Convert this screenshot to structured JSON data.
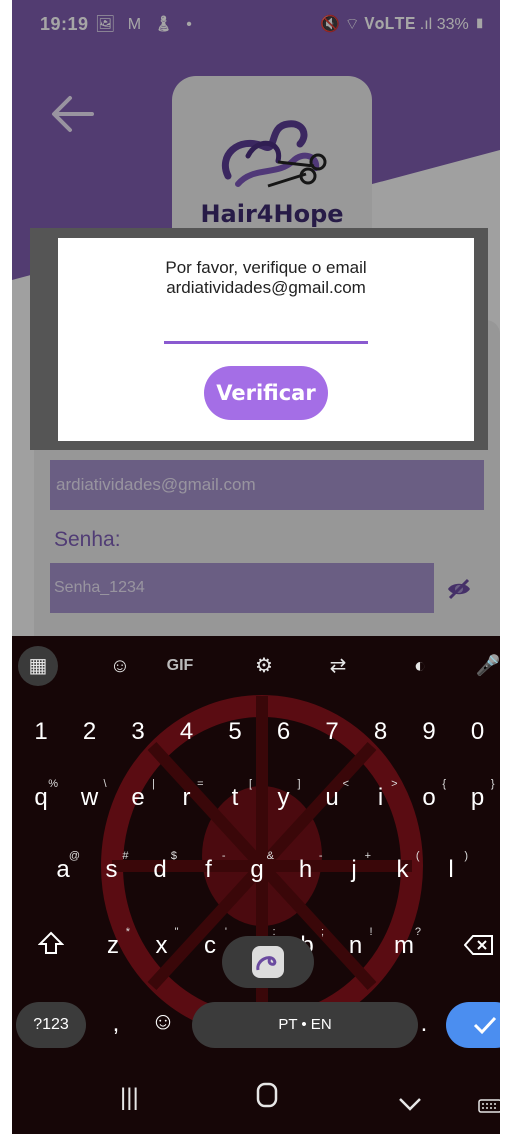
{
  "status_bar": {
    "time": "19:19",
    "left_icons": "🖼 M ♟ •",
    "right_text": "33%",
    "right_icons": "🔇 ⌔ 𝐕𝐨𝐋𝐓𝐄 .ıl"
  },
  "app": {
    "back_icon": "arrow-left",
    "logo_text": "Hair4Hope",
    "colors": {
      "primary": "#7e5cae",
      "field": "#a391c9",
      "label": "#7c5cb4",
      "button": "#a46ee6"
    },
    "email_value": "ardiatividades@gmail.com",
    "password_label": "Senha:",
    "password_value": "Senha_1234"
  },
  "dialog": {
    "line1": "Por favor, verifique o email",
    "line2": "ardiatividades@gmail.com",
    "button_label": "Verificar"
  },
  "keyboard": {
    "toolbar": [
      "apps",
      "sticker",
      "GIF",
      "settings",
      "translate",
      "palette",
      "mic"
    ],
    "gif_label": "GIF",
    "num_row": [
      "1",
      "2",
      "3",
      "4",
      "5",
      "6",
      "7",
      "8",
      "9",
      "0"
    ],
    "row1": [
      {
        "k": "q",
        "s": "%"
      },
      {
        "k": "w",
        "s": "\\"
      },
      {
        "k": "e",
        "s": "|"
      },
      {
        "k": "r",
        "s": "="
      },
      {
        "k": "t",
        "s": "["
      },
      {
        "k": "y",
        "s": "]"
      },
      {
        "k": "u",
        "s": "<"
      },
      {
        "k": "i",
        "s": ">"
      },
      {
        "k": "o",
        "s": "{"
      },
      {
        "k": "p",
        "s": "}"
      }
    ],
    "row2": [
      {
        "k": "a",
        "s": "@"
      },
      {
        "k": "s",
        "s": "#"
      },
      {
        "k": "d",
        "s": "$"
      },
      {
        "k": "f",
        "s": "-"
      },
      {
        "k": "g",
        "s": "&"
      },
      {
        "k": "h",
        "s": "-"
      },
      {
        "k": "j",
        "s": "+"
      },
      {
        "k": "k",
        "s": "("
      },
      {
        "k": "l",
        "s": ")"
      }
    ],
    "row3": [
      {
        "k": "z",
        "s": "*"
      },
      {
        "k": "x",
        "s": "\""
      },
      {
        "k": "c",
        "s": "'"
      },
      {
        "k": "v",
        "s": ":"
      },
      {
        "k": "b",
        "s": ";"
      },
      {
        "k": "n",
        "s": "!"
      },
      {
        "k": "m",
        "s": "?"
      }
    ],
    "symbols_label": "?123",
    "comma": ",",
    "space_label": "PT • EN",
    "period": "."
  }
}
